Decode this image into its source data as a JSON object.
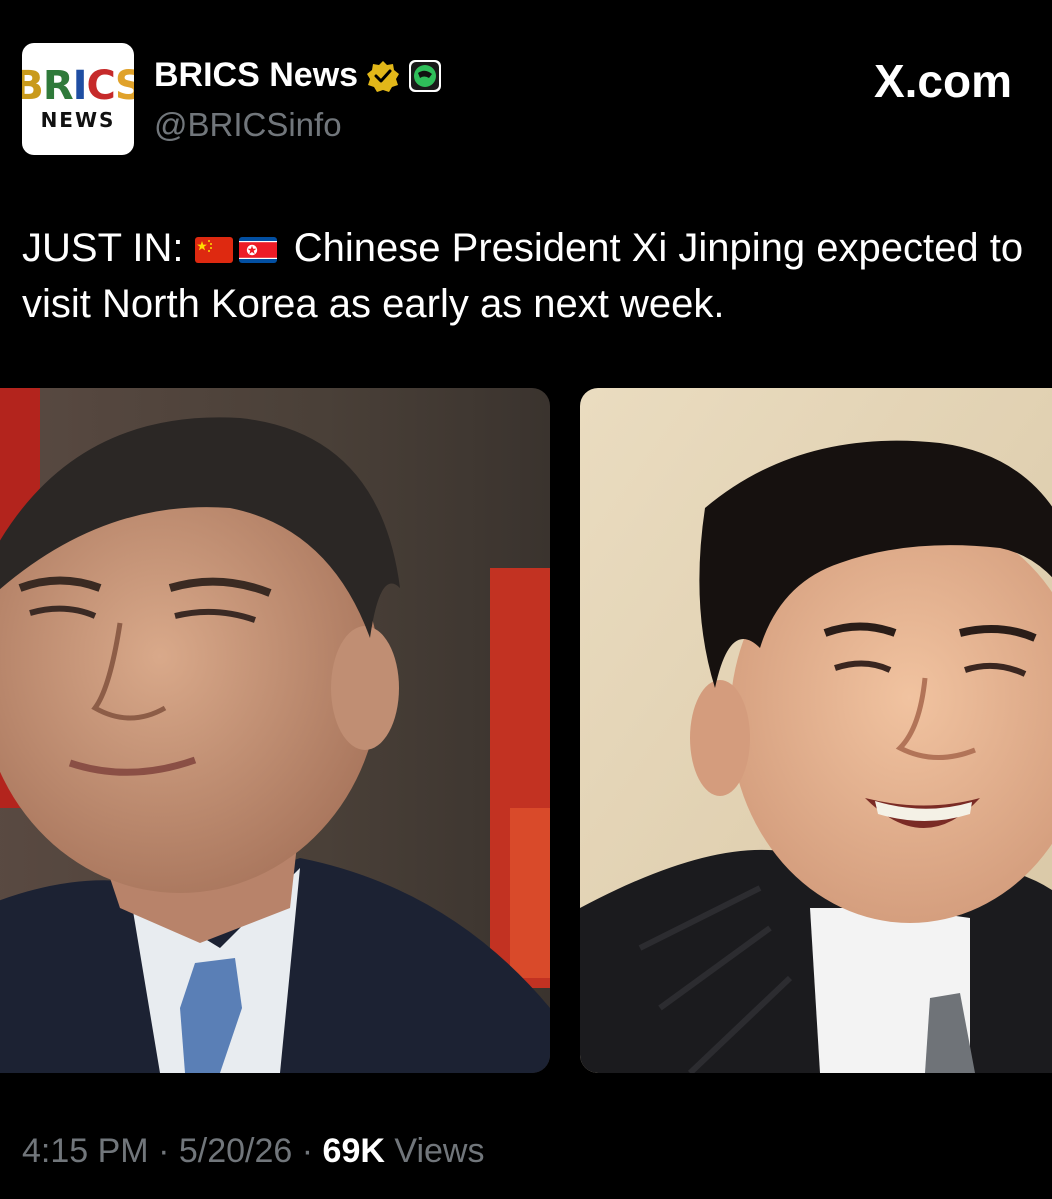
{
  "header": {
    "avatar": {
      "logo_top": [
        "B",
        "R",
        "I",
        "C",
        "S"
      ],
      "logo_bottom": "NEWS"
    },
    "display_name": "BRICS News",
    "badges": [
      "verified-gold-badge-icon",
      "affiliate-badge-icon"
    ],
    "handle": "@BRICSinfo",
    "source": "X.com"
  },
  "tweet": {
    "prefix": "JUST IN:",
    "flags": [
      "china-flag-icon",
      "north-korea-flag-icon"
    ],
    "body": "Chinese President Xi Jinping expected to visit North Korea as early as next week."
  },
  "media": [
    {
      "icon": "portrait-photo-left"
    },
    {
      "icon": "portrait-photo-right"
    }
  ],
  "footer": {
    "time": "4:15 PM",
    "separator": "·",
    "date": "5/20/26",
    "views_count": "69K",
    "views_label": "Views"
  },
  "colors": {
    "background": "#000000",
    "text": "#ffffff",
    "muted": "#71767b",
    "verified_gold": "#e2b719"
  }
}
